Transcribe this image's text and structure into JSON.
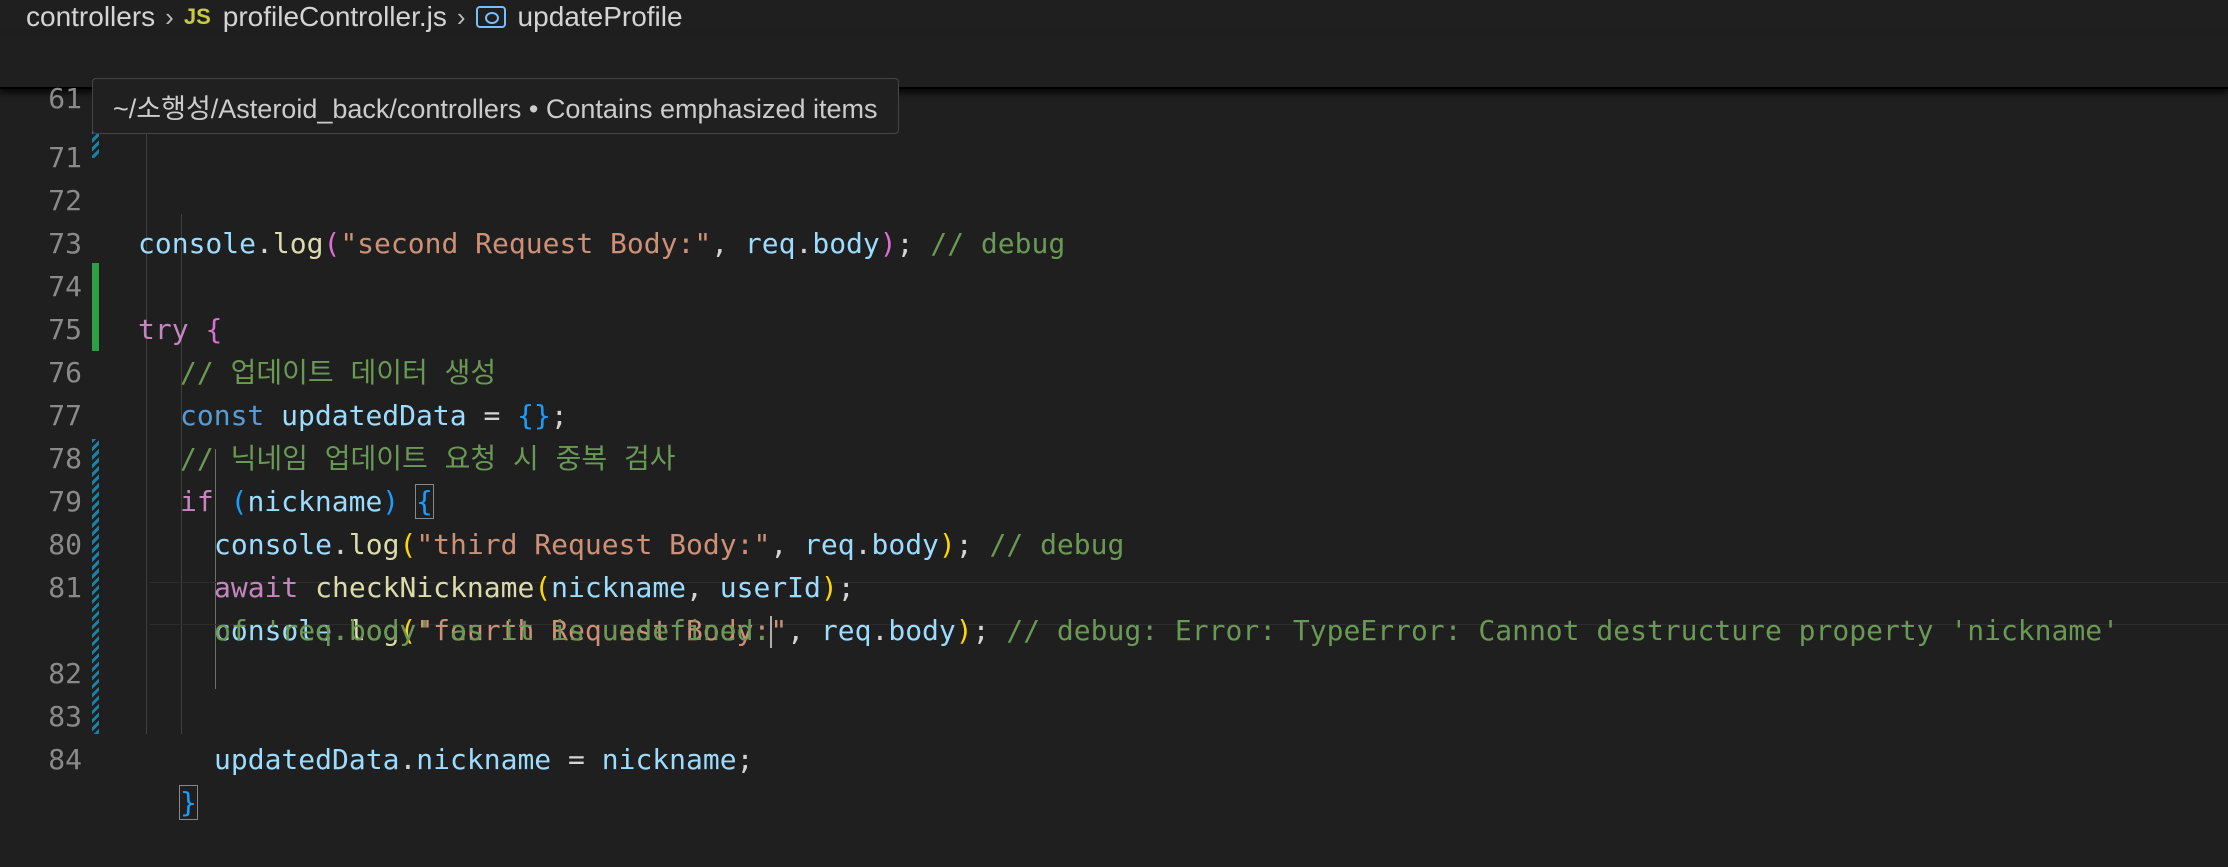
{
  "breadcrumb": {
    "folder": "controllers",
    "js_badge": "JS",
    "file": "profileController.js",
    "symbol": "updateProfile"
  },
  "sticky_line": {
    "number": "61"
  },
  "tooltip": {
    "text": "~/소행성/Asteroid_back/controllers • Contains emphasized items"
  },
  "lines": [
    {
      "n": "71"
    },
    {
      "n": "72",
      "t": [
        "console",
        ".",
        "log",
        "(",
        "\"second Request Body:\"",
        ", ",
        "req",
        ".",
        "body",
        ")",
        "; ",
        "// debug"
      ]
    },
    {
      "n": "73"
    },
    {
      "n": "74",
      "t": [
        "try",
        " ",
        "{"
      ]
    },
    {
      "n": "75",
      "t": [
        "// 업데이트 데이터 생성"
      ]
    },
    {
      "n": "76",
      "t": [
        "const",
        " ",
        "updatedData",
        " = ",
        "{}",
        ";"
      ]
    },
    {
      "n": "77",
      "t": [
        "// 닉네임 업데이트 요청 시 중복 검사"
      ]
    },
    {
      "n": "78",
      "t": [
        "if",
        " ",
        "(",
        "nickname",
        ")",
        " ",
        "{"
      ]
    },
    {
      "n": "79",
      "t": [
        "console",
        ".",
        "log",
        "(",
        "\"third Request Body:\"",
        ", ",
        "req",
        ".",
        "body",
        ")",
        "; ",
        "// debug"
      ]
    },
    {
      "n": "80",
      "t": [
        "await",
        " ",
        "checkNickname",
        "(",
        "nickname",
        ", ",
        "userId",
        ")",
        ";"
      ]
    },
    {
      "n": "81",
      "t": [
        "console",
        ".",
        "log",
        "(",
        "\"fourth Request Body:\"",
        ", ",
        "req",
        ".",
        "body",
        ")",
        "; ",
        "// debug: Error: TypeError: Cannot destructure property 'nickname'"
      ]
    },
    {
      "n": "",
      "t": [
        "of 'req.body' as it is undefined."
      ]
    },
    {
      "n": "82"
    },
    {
      "n": "83",
      "t": [
        "updatedData",
        ".",
        "nickname",
        " = ",
        "nickname",
        ";"
      ]
    },
    {
      "n": "84",
      "t": [
        "}"
      ]
    }
  ]
}
